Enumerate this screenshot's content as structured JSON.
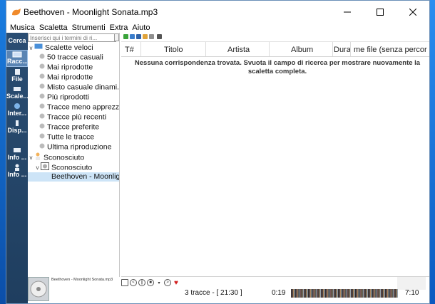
{
  "window": {
    "title": "Beethoven - Moonlight Sonata.mp3"
  },
  "menu": [
    "Musica",
    "Scaletta",
    "Strumenti",
    "Extra",
    "Aiuto"
  ],
  "sidebar": [
    {
      "label": "Cerca",
      "icon": "search-icon"
    },
    {
      "label": "Racc...",
      "icon": "library-icon",
      "active": true
    },
    {
      "label": "File",
      "icon": "file-icon"
    },
    {
      "label": "Scale...",
      "icon": "playlist-icon"
    },
    {
      "label": "Inter...",
      "icon": "internet-icon"
    },
    {
      "label": "Disp...",
      "icon": "device-icon"
    },
    {
      "label": "Info ...",
      "icon": "song-info-icon"
    },
    {
      "label": "Info ...",
      "icon": "artist-info-icon"
    }
  ],
  "library": {
    "filter_placeholder": "Inserisci qui i termini di ri...",
    "tree": [
      {
        "label": "Scalette veloci",
        "expanded": true
      },
      {
        "label": "50 tracce casuali"
      },
      {
        "label": "Mai riprodotte"
      },
      {
        "label": "Mai riprodotte"
      },
      {
        "label": "Misto casuale dinami..."
      },
      {
        "label": "Più riprodotti"
      },
      {
        "label": "Tracce meno apprezz..."
      },
      {
        "label": "Tracce più recenti"
      },
      {
        "label": "Tracce preferite"
      },
      {
        "label": "Tutte le tracce"
      },
      {
        "label": "Ultima riproduzione"
      },
      {
        "label": "Sconosciuto",
        "expanded": true
      },
      {
        "label": "Sconosciuto",
        "expanded": true
      },
      {
        "label": "Beethoven - Moonligh...",
        "selected": true
      }
    ]
  },
  "playlist": {
    "columns": [
      "T#",
      "Titolo",
      "Artista",
      "Album",
      "Durat",
      "me file (senza percor"
    ],
    "empty_message": "Nessuna corrispondenza trovata. Svuota il campo di ricerca per mostrare nuovamente la scaletta completa."
  },
  "now_playing": {
    "text": "Beethoven - Moonlight Sonata.mp3"
  },
  "status": {
    "tracks": "3 tracce - [ 21:30 ]",
    "position": "0:19",
    "length": "7:10"
  },
  "colors": {
    "accent": "#2a4d72",
    "selection": "#cde4f7"
  }
}
